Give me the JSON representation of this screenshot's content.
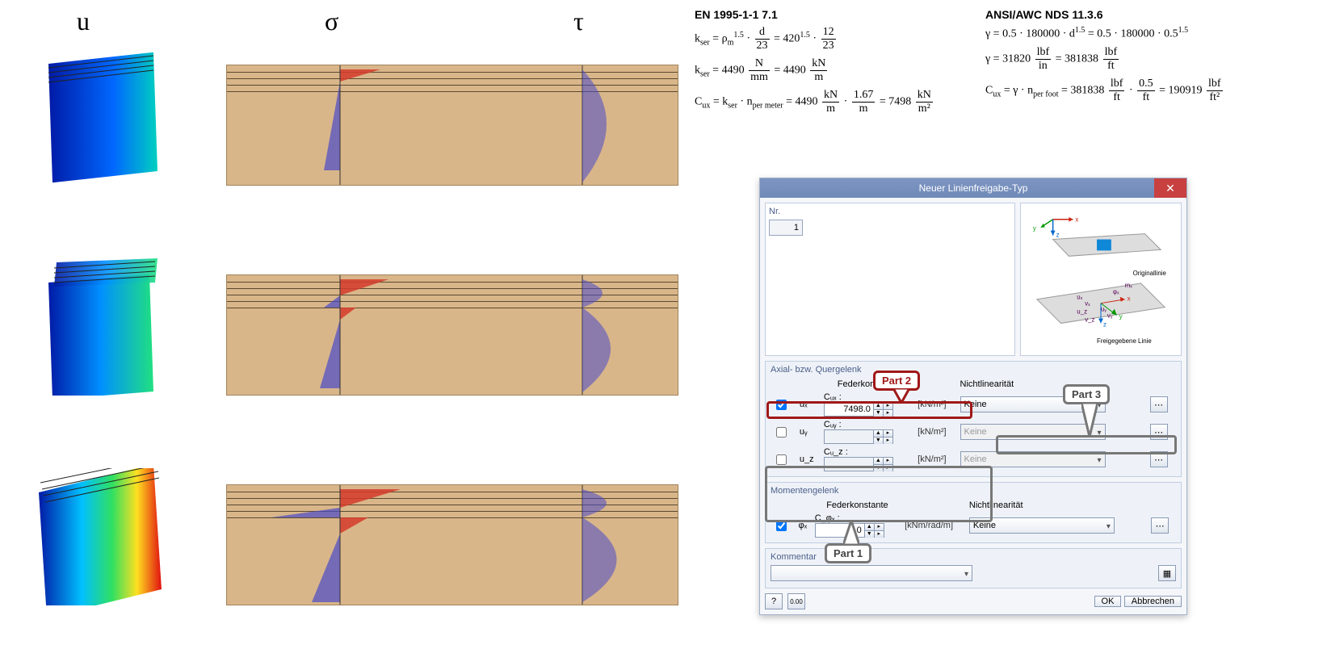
{
  "columns": {
    "u": "u",
    "sigma": "σ",
    "tau": "τ"
  },
  "formulae": {
    "eu": {
      "title": "EN 1995-1-1 7.1",
      "l1_left": "k",
      "l1a": " = ρ",
      "l1b": " · ",
      "l1_frac_n": "d",
      "l1_frac_d": "23",
      "l1_mid": " = 420",
      "l1_exp": "1.5",
      "l1_dot": " · ",
      "l1_frac2_n": "12",
      "l1_frac2_d": "23",
      "l2a": "k",
      "l2b": " = 4490 ",
      "l2_frac_n": "N",
      "l2_frac_d": "mm",
      "l2_mid": " = 4490 ",
      "l2_frac2_n": "kN",
      "l2_frac2_d": "m",
      "l3a": "C",
      "l3b": " = k",
      "l3c": " · n",
      "l3_sub": "per meter",
      "l3d": " = 4490 ",
      "l3_frac_n": "kN",
      "l3_frac_d": "m",
      "l3e": " · ",
      "l3_frac2_n": "1.67",
      "l3_frac2_d": "m",
      "l3f": " = 7498 ",
      "l3_frac3_n": "kN",
      "l3_frac3_d": "m²"
    },
    "us": {
      "title": "ANSI/AWC NDS 11.3.6",
      "l1a": "γ = 0.5 · 180000 · d",
      "l1_exp": "1.5",
      "l1b": " = 0.5 · 180000 · 0.5",
      "l1_exp2": "1.5",
      "l2a": "γ = 31820 ",
      "l2_frac_n": "lbf",
      "l2_frac_d": "in",
      "l2b": " = 381838 ",
      "l2_frac2_n": "lbf",
      "l2_frac2_d": "ft",
      "l3a": "C",
      "l3b": " = γ · n",
      "l3_sub": "per foot",
      "l3c": " = 381838 ",
      "l3_frac_n": "lbf",
      "l3_frac_d": "ft",
      "l3d": " · ",
      "l3_frac2_n": "0.5",
      "l3_frac2_d": "ft",
      "l3e": " = 190919 ",
      "l3_frac3_n": "lbf",
      "l3_frac3_d": "ft²"
    }
  },
  "dialog": {
    "title": "Neuer Linienfreigabe-Typ",
    "nr_label": "Nr.",
    "nr_value": "1",
    "axis": {
      "original": "Originallinie",
      "released": "Freigegebene Linie",
      "labels": [
        "mₓ",
        "φₓ",
        "uₓ",
        "vₓ",
        "uᵧ",
        "vᵧ",
        "u_z",
        "v_z",
        "x",
        "y",
        "z"
      ]
    },
    "axial": {
      "title": "Axial- bzw. Quergelenk",
      "fed_label": "Federkonstante",
      "nl_label": "Nichtlinearität",
      "rows": [
        {
          "name": "uₓ",
          "clabel": "Cᵤₓ",
          "value": "7498.0",
          "unit": "[kN/m²]",
          "checked": true,
          "nlin": "Keine",
          "enabled": true
        },
        {
          "name": "uᵧ",
          "clabel": "Cᵤᵧ",
          "value": "",
          "unit": "[kN/m²]",
          "checked": false,
          "nlin": "Keine",
          "enabled": false
        },
        {
          "name": "u_z",
          "clabel": "Cᵤ_z",
          "value": "",
          "unit": "[kN/m²]",
          "checked": false,
          "nlin": "Keine",
          "enabled": false
        }
      ]
    },
    "moment": {
      "title": "Momentengelenk",
      "fed_label": "Federkonstante",
      "nl_label": "Nichtlinearität",
      "row": {
        "name": "φₓ",
        "clabel": "C_φₓ",
        "value": "0.0",
        "unit": "[kNm/rad/m]",
        "checked": true,
        "nlin": "Keine"
      }
    },
    "comment": {
      "title": "Kommentar"
    },
    "buttons": {
      "ok": "OK",
      "cancel": "Abbrechen"
    },
    "callouts": {
      "p1": "Part 1",
      "p2": "Part 2",
      "p3": "Part 3"
    }
  }
}
